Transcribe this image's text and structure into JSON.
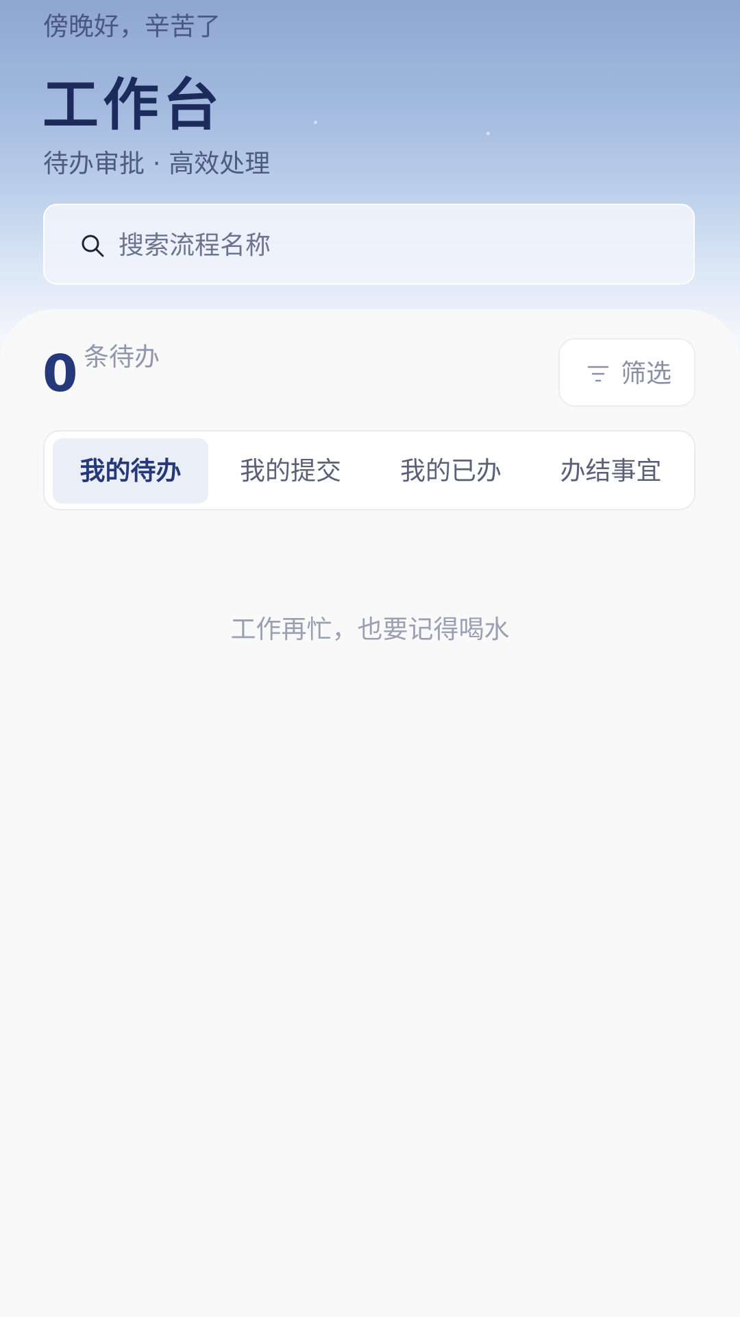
{
  "header": {
    "greeting": "傍晚好，辛苦了",
    "title": "工作台",
    "subtitle": "待办审批 · 高效处理"
  },
  "search": {
    "placeholder": "搜索流程名称",
    "value": "",
    "icon": "search-icon"
  },
  "summary": {
    "count": "0",
    "count_label": "条待办"
  },
  "filter": {
    "label": "筛选",
    "icon": "filter-icon"
  },
  "tabs": [
    {
      "label": "我的待办",
      "active": true
    },
    {
      "label": "我的提交",
      "active": false
    },
    {
      "label": "我的已办",
      "active": false
    },
    {
      "label": "办结事宜",
      "active": false
    }
  ],
  "empty_state": {
    "message": "工作再忙，也要记得喝水"
  },
  "colors": {
    "primary": "#24387a",
    "title": "#1d2a5c",
    "active_tab_bg": "#eaeef7",
    "muted_text": "#9aa0b2",
    "background": "#f9f9fa"
  }
}
